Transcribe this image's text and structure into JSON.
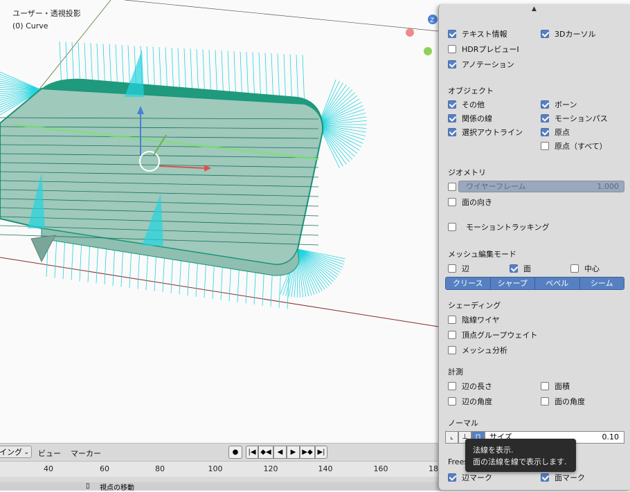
{
  "viewport": {
    "view_title": "ユーザー・透視投影",
    "object_label": "(0) Curve",
    "gizmo_axis": "Z"
  },
  "timeline": {
    "mode_select": "イング",
    "menus": [
      "ビュー",
      "マーカー"
    ],
    "ticks": [
      "40",
      "60",
      "80",
      "100",
      "120",
      "140",
      "160",
      "18"
    ],
    "bottom_label": "視点の移動"
  },
  "overlay": {
    "top_left": [
      {
        "label": "テキスト情報",
        "checked": true
      },
      {
        "label": "HDRプレビューI",
        "checked": false
      },
      {
        "label": "アノテーション",
        "checked": true
      }
    ],
    "top_right": [
      {
        "label": "3Dカーソル",
        "checked": true
      }
    ],
    "objects_header": "オブジェクト",
    "objects_left": [
      {
        "label": "その他",
        "checked": true
      },
      {
        "label": "関係の線",
        "checked": true
      },
      {
        "label": "選択アウトライン",
        "checked": true
      }
    ],
    "objects_right": [
      {
        "label": "ボーン",
        "checked": true
      },
      {
        "label": "モーションパス",
        "checked": true
      },
      {
        "label": "原点",
        "checked": true
      },
      {
        "label": "原点（すべて）",
        "checked": false
      }
    ],
    "geometry_header": "ジオメトリ",
    "wireframe": {
      "label": "ワイヤーフレーム",
      "value": "1.000",
      "checked": false
    },
    "face_orientation": {
      "label": "面の向き",
      "checked": false
    },
    "motion_tracking": {
      "label": "モーショントラッキング",
      "checked": false
    },
    "mesh_edit_header": "メッシュ編集モード",
    "mesh_edit": [
      {
        "label": "辺",
        "checked": false
      },
      {
        "label": "面",
        "checked": true
      },
      {
        "label": "中心",
        "checked": false
      }
    ],
    "mesh_segments": [
      "クリース",
      "シャープ",
      "ベベル",
      "シーム"
    ],
    "shading_header": "シェーディング",
    "shading": [
      {
        "label": "陰線ワイヤ",
        "checked": false
      },
      {
        "label": "頂点グループウェイト",
        "checked": false
      },
      {
        "label": "メッシュ分析",
        "checked": false
      }
    ],
    "measure_header": "計測",
    "measure_left": [
      {
        "label": "辺の長さ",
        "checked": false
      },
      {
        "label": "辺の角度",
        "checked": false
      }
    ],
    "measure_right": [
      {
        "label": "面積",
        "checked": false
      },
      {
        "label": "面の角度",
        "checked": false
      }
    ],
    "normal_header": "ノーマル",
    "normal_size_label": "サイズ",
    "normal_size_value": "0.10",
    "freestyle_header": "Frees",
    "freestyle": [
      {
        "label": "辺マーク",
        "checked": true
      },
      {
        "label": "面マーク",
        "checked": true
      }
    ]
  },
  "tooltip": {
    "line1": "法線を表示.",
    "line2": "面の法線を線で表示します."
  },
  "colors": {
    "accent": "#5680c2",
    "mesh_fill": "#9ec9bb",
    "mesh_edge": "#179478",
    "normals": "#22d4e0"
  }
}
